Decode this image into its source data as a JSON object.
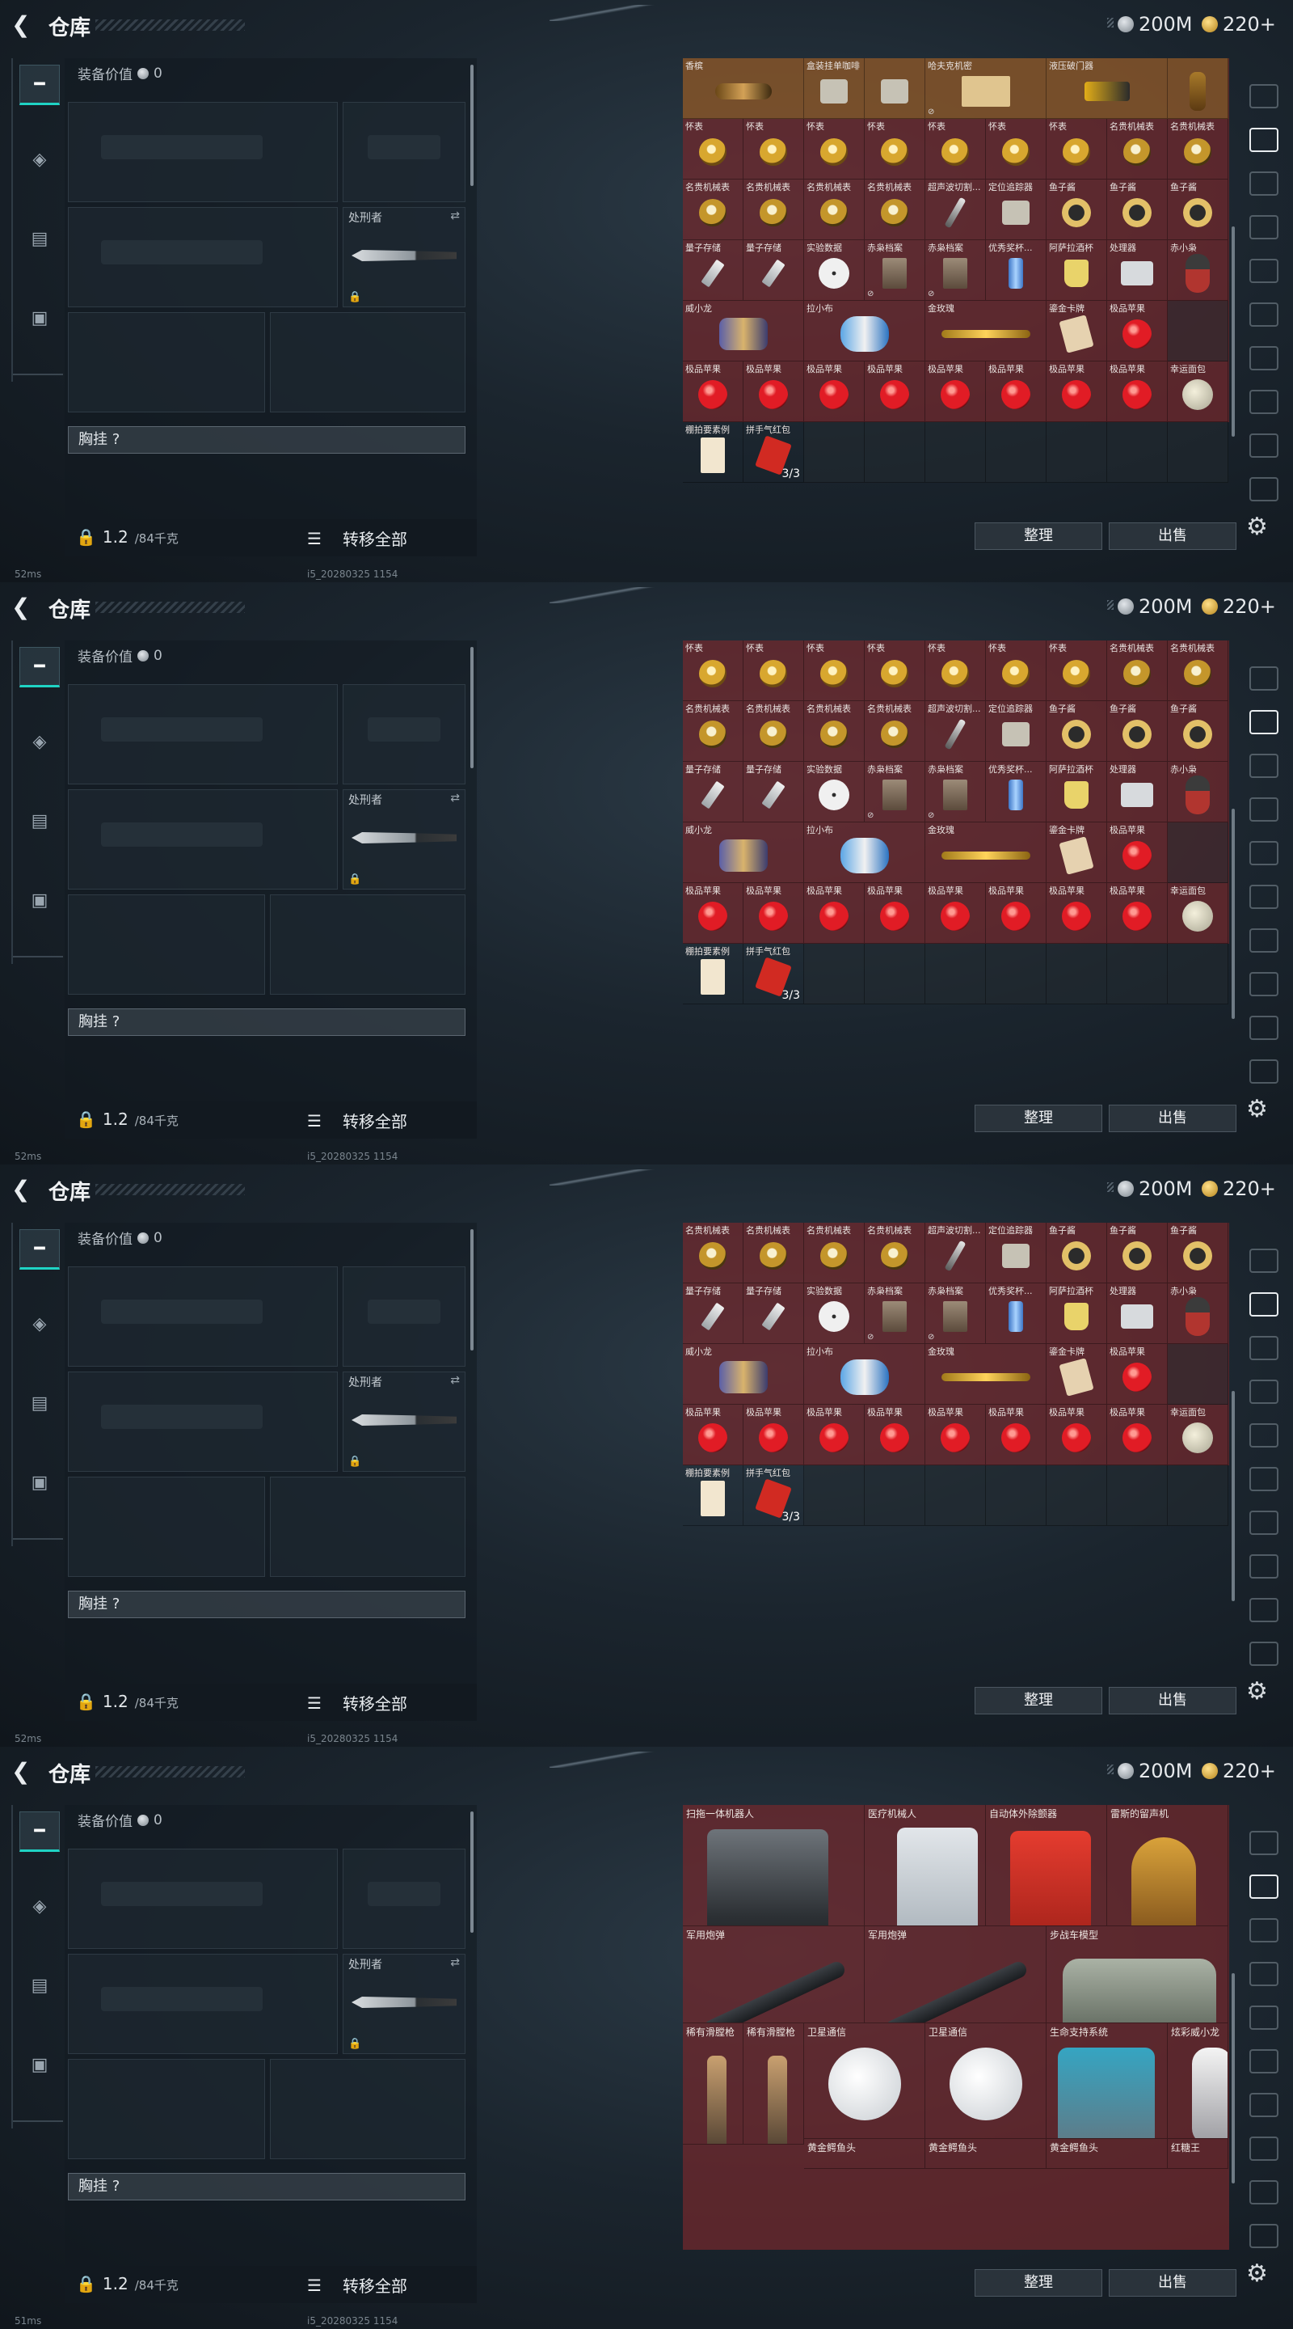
{
  "header": {
    "back_icon": "back-arrow-icon",
    "title": "仓库",
    "currency_silver": "200M",
    "currency_gold": "220+"
  },
  "left": {
    "equip_value_label": "装备价值",
    "equip_value": "0",
    "sidearm_slot_label": "处刑者",
    "chest_label": "胸挂 ?",
    "weight": "1.2",
    "weight_cap": "/84千克",
    "transfer_all": "转移全部"
  },
  "status": {
    "ping_1": "52ms",
    "ping_2": "52ms",
    "ping_3": "52ms",
    "ping_4": "51ms",
    "build": "i5_20280325 1154"
  },
  "buttons": {
    "sort": "整理",
    "sell": "出售"
  },
  "inventory_rows": [
    [
      {
        "n": "香槟",
        "i": "bottle",
        "w": 2
      },
      {
        "n": "盒装挂单咖啡",
        "i": "box",
        "w": 1
      },
      {
        "n": "",
        "i": "box",
        "w": 1
      },
      {
        "n": "哈夫克机密",
        "i": "mapp",
        "w": 2,
        "lock": true
      },
      {
        "n": "液压破门器",
        "i": "flash",
        "w": 2
      },
      {
        "n": "",
        "i": "vase",
        "w": 1
      }
    ],
    [
      {
        "n": "怀表",
        "i": "watch"
      },
      {
        "n": "怀表",
        "i": "watch"
      },
      {
        "n": "怀表",
        "i": "watch"
      },
      {
        "n": "怀表",
        "i": "watch"
      },
      {
        "n": "怀表",
        "i": "watch"
      },
      {
        "n": "怀表",
        "i": "watch"
      },
      {
        "n": "怀表",
        "i": "watch"
      },
      {
        "n": "名贵机械表",
        "i": "gwatch"
      },
      {
        "n": "名贵机械表",
        "i": "gwatch"
      }
    ],
    [
      {
        "n": "名贵机械表",
        "i": "gwatch"
      },
      {
        "n": "名贵机械表",
        "i": "gwatch"
      },
      {
        "n": "名贵机械表",
        "i": "gwatch"
      },
      {
        "n": "名贵机械表",
        "i": "gwatch"
      },
      {
        "n": "超声波切割...",
        "i": "pen"
      },
      {
        "n": "定位追踪器",
        "i": "box"
      },
      {
        "n": "鱼子酱",
        "i": "ring"
      },
      {
        "n": "鱼子酱",
        "i": "ring"
      },
      {
        "n": "鱼子酱",
        "i": "ring"
      }
    ],
    [
      {
        "n": "量子存储",
        "i": "usb"
      },
      {
        "n": "量子存储",
        "i": "usb"
      },
      {
        "n": "实验数据",
        "i": "disc"
      },
      {
        "n": "赤枭档案",
        "i": "file",
        "lock": true
      },
      {
        "n": "赤枭档案",
        "i": "file",
        "lock": true
      },
      {
        "n": "优秀奖杯...",
        "i": "can"
      },
      {
        "n": "阿萨拉酒杯",
        "i": "cup"
      },
      {
        "n": "处理器",
        "i": "cam"
      },
      {
        "n": "赤小枭",
        "i": "doll"
      }
    ],
    [
      {
        "n": "威小龙",
        "i": "dragon",
        "w": 2
      },
      {
        "n": "拉小布",
        "i": "blue",
        "w": 2
      },
      {
        "n": "金玫瑰",
        "i": "rose",
        "w": 2
      },
      {
        "n": "鎏金卡牌",
        "i": "card",
        "w": 1
      },
      {
        "n": "极品苹果",
        "i": "apple",
        "w": 1
      },
      {
        "n": "",
        "i": "",
        "w": 1
      }
    ],
    [
      {
        "n": "极品苹果",
        "i": "apple"
      },
      {
        "n": "极品苹果",
        "i": "apple"
      },
      {
        "n": "极品苹果",
        "i": "apple"
      },
      {
        "n": "极品苹果",
        "i": "apple"
      },
      {
        "n": "极品苹果",
        "i": "apple"
      },
      {
        "n": "极品苹果",
        "i": "apple"
      },
      {
        "n": "极品苹果",
        "i": "apple"
      },
      {
        "n": "极品苹果",
        "i": "apple"
      },
      {
        "n": "幸运面包",
        "i": "moon"
      }
    ],
    [
      {
        "n": "棚拍要素例",
        "i": "note"
      },
      {
        "n": "拼手气红包",
        "i": "red",
        "qty": "3/3"
      }
    ]
  ],
  "big_items": [
    {
      "n": "扫拖一体机器人",
      "i": "robot",
      "c": 0,
      "r": 0,
      "w": 3,
      "h": 2
    },
    {
      "n": "医疗机械人",
      "i": "med",
      "c": 3,
      "r": 0,
      "w": 2,
      "h": 2
    },
    {
      "n": "自动体外除颤器",
      "i": "aed",
      "c": 5,
      "r": 0,
      "w": 2,
      "h": 2
    },
    {
      "n": "雷斯的留声机",
      "i": "gram",
      "c": 7,
      "r": 0,
      "w": 2,
      "h": 2
    },
    {
      "n": "军用炮弹",
      "i": "missile",
      "c": 0,
      "r": 2,
      "w": 3,
      "h": 1.6
    },
    {
      "n": "军用炮弹",
      "i": "missile",
      "c": 3,
      "r": 2,
      "w": 3,
      "h": 1.6
    },
    {
      "n": "步战车模型",
      "i": "tank",
      "c": 6,
      "r": 2,
      "w": 3,
      "h": 1.6
    },
    {
      "n": "稀有滑膛枪",
      "i": "pistol",
      "c": 0,
      "r": 3.6,
      "w": 1,
      "h": 2
    },
    {
      "n": "稀有滑膛枪",
      "i": "pistol",
      "c": 1,
      "r": 3.6,
      "w": 1,
      "h": 2
    },
    {
      "n": "卫星通信",
      "i": "dish",
      "c": 2,
      "r": 3.6,
      "w": 2,
      "h": 1.9
    },
    {
      "n": "卫星通信",
      "i": "dish",
      "c": 4,
      "r": 3.6,
      "w": 2,
      "h": 1.9
    },
    {
      "n": "生命支持系统",
      "i": "engine",
      "c": 6,
      "r": 3.6,
      "w": 2,
      "h": 1.9
    },
    {
      "n": "炫彩威小龙",
      "i": "figure",
      "c": 8,
      "r": 3.6,
      "w": 1,
      "h": 1.9
    },
    {
      "n": "黄金鳄鱼头",
      "i": "",
      "c": 2,
      "r": 5.5,
      "w": 2,
      "h": 0.5
    },
    {
      "n": "黄金鳄鱼头",
      "i": "",
      "c": 4,
      "r": 5.5,
      "w": 2,
      "h": 0.5
    },
    {
      "n": "黄金鳄鱼头",
      "i": "",
      "c": 6,
      "r": 5.5,
      "w": 2,
      "h": 0.5
    },
    {
      "n": "红糖王",
      "i": "",
      "c": 8,
      "r": 5.5,
      "w": 1,
      "h": 0.5
    }
  ]
}
